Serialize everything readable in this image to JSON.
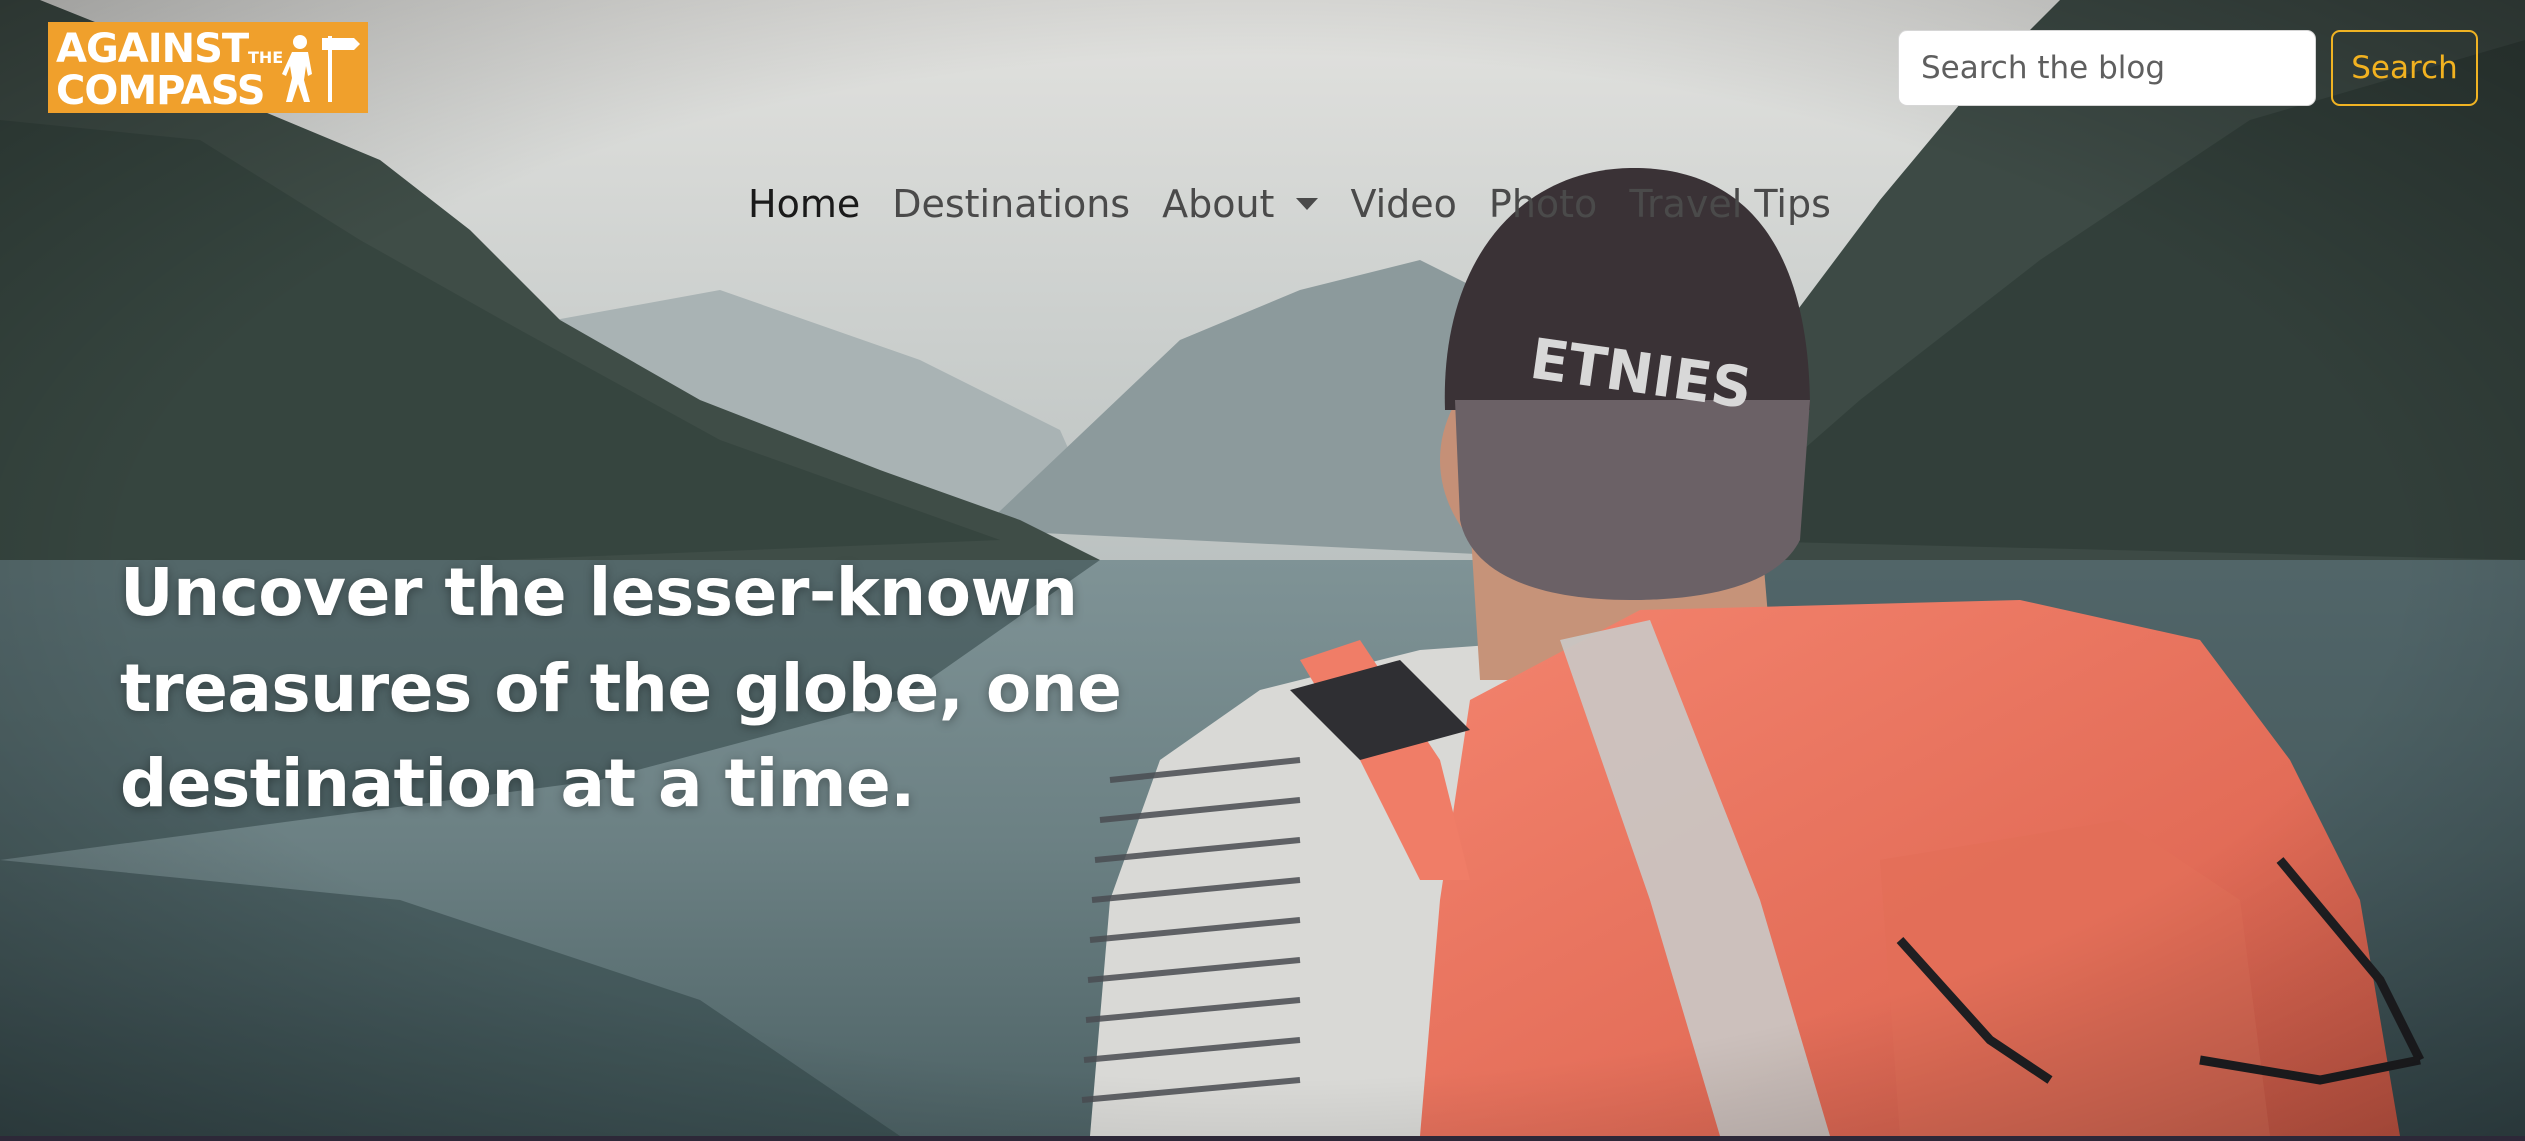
{
  "logo": {
    "line1": "AGAINST",
    "line2": "COMPASS",
    "the": "THE"
  },
  "search": {
    "placeholder": "Search the blog",
    "value": "",
    "button_label": "Search"
  },
  "nav": {
    "items": [
      {
        "label": "Home",
        "active": true
      },
      {
        "label": "Destinations",
        "active": false
      },
      {
        "label": "About",
        "active": false,
        "dropdown": true
      },
      {
        "label": "Video",
        "active": false
      },
      {
        "label": "Photo",
        "active": false
      },
      {
        "label": "Travel Tips",
        "active": false
      }
    ]
  },
  "hero": {
    "headline": "Uncover the lesser-known treasures of the globe, one destination at a time.",
    "image_alt": "hiker-with-orange-backpack-at-mountain-lake"
  },
  "colors": {
    "brand_orange": "#f0a02c",
    "search_accent": "#f0b323",
    "backpack": "#ee7560",
    "headline": "#ffffff"
  }
}
